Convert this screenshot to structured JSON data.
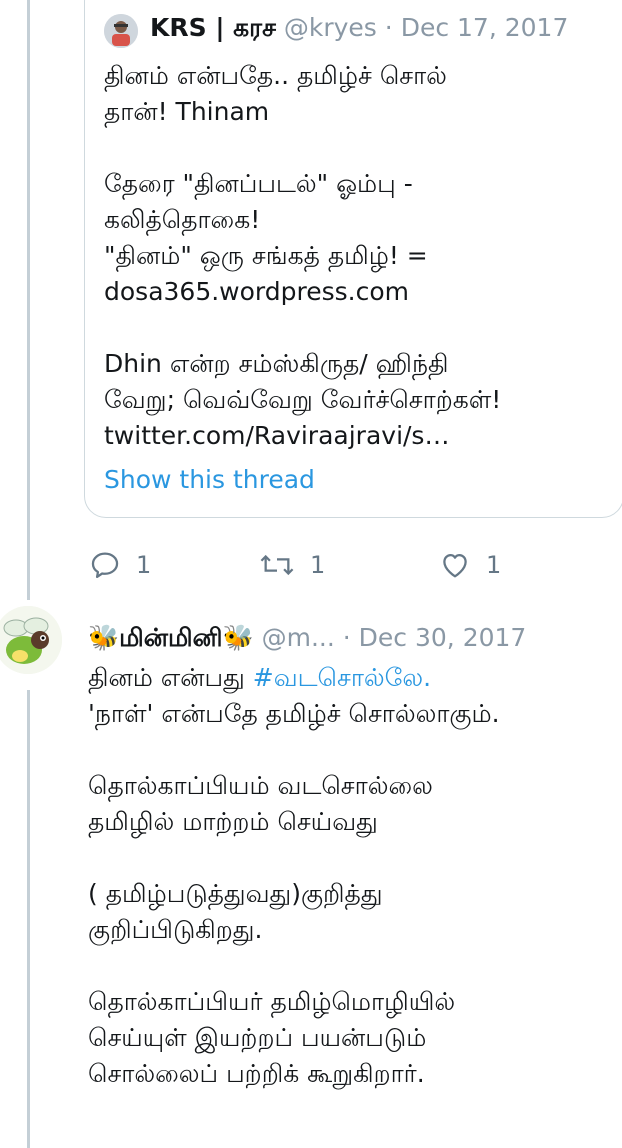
{
  "quoted_tweet": {
    "name": "KRS | கரச",
    "handle": "@kryes",
    "separator": "·",
    "date": "Dec 17, 2017",
    "body": "தினம் என்பதே.. தமிழ்ச் சொல்\nதான்! Thinam\n\nதேரை \"தினப்படல்\" ஓம்பு -\nகலித்தொகை!\n\"தினம்\" ஒரு சங்கத் தமிழ்! =\ndosa365.wordpress.com\n\nDhin என்ற சம்ஸ்கிருத/ ஹிந்தி\nவேறு; வெவ்வேறு வேர்ச்சொற்கள்!\ntwitter.com/Raviraajravi/s…",
    "show_thread": "Show this thread"
  },
  "actions": {
    "reply_count": "1",
    "retweet_count": "1",
    "like_count": "1"
  },
  "reply_tweet": {
    "name": "மின்மினி",
    "emoji_left": "🐝",
    "emoji_right": "🐝",
    "handle": "@m...",
    "separator": "·",
    "date": "Dec 30, 2017",
    "body_line1_prefix": "தினம் என்பது ",
    "hashtag": "#வடசொல்லே.",
    "body_rest": "\n'நாள்' என்பதே தமிழ்ச் சொல்லாகும்.\n\nதொல்காப்பியம் வடசொல்லை\nதமிழில் மாற்றம் செய்வது\n\n( தமிழ்படுத்துவது)குறித்து\nகுறிப்பிடுகிறது.\n\nதொல்காப்பியர் தமிழ்மொழியில்\nசெய்யுள் இயற்றப் பயன்படும்\nசொல்லைப் பற்றிக் கூறுகிறார்."
  },
  "colors": {
    "link": "#2a97e0",
    "muted": "#8a98a5",
    "border": "#cfd9de",
    "thread_line": "#c4cfd6"
  }
}
